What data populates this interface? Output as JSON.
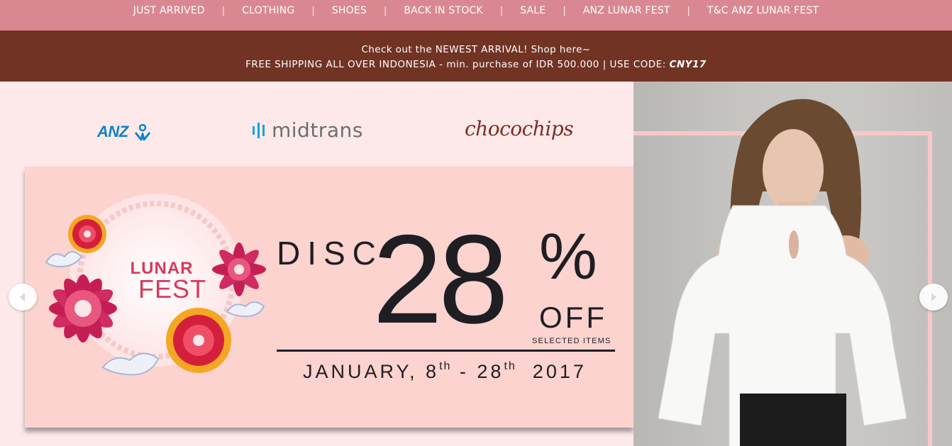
{
  "nav": {
    "items": [
      {
        "label": "JUST ARRIVED"
      },
      {
        "label": "CLOTHING"
      },
      {
        "label": "SHOES"
      },
      {
        "label": "BACK IN STOCK"
      },
      {
        "label": "SALE"
      },
      {
        "label": "ANZ LUNAR FEST"
      },
      {
        "label": "T&C ANZ LUNAR FEST"
      }
    ],
    "separator": "|"
  },
  "promo": {
    "line1": "Check out the NEWEST ARRIVAL! Shop here~",
    "line2_prefix": "FREE SHIPPING ALL OVER INDONESIA - min. purchase of IDR 500.000 | USE CODE: ",
    "code": "CNY17"
  },
  "hero": {
    "sponsors": {
      "anz": "ANZ",
      "midtrans": "midtrans",
      "chocochips": "chocochips"
    },
    "event": {
      "line1": "LUNAR",
      "line2": "FEST"
    },
    "discount": {
      "word": "DISC",
      "number": "28",
      "percent": "%",
      "off": "OFF",
      "selected": "SELECTED ITEMS",
      "date_month": "JANUARY, 8",
      "date_sup1": "th",
      "date_mid": " - 28",
      "date_sup2": "th",
      "date_year": "  2017"
    }
  },
  "colors": {
    "nav_bg": "#d98891",
    "promo_bg": "#713324",
    "hero_bg": "#fde9ea",
    "banner_bg": "#fcd3ce",
    "accent_red": "#d83a5c",
    "anz_blue": "#0a86c9"
  },
  "icons": {
    "prev": "chevron-left-icon",
    "next": "chevron-right-icon"
  }
}
